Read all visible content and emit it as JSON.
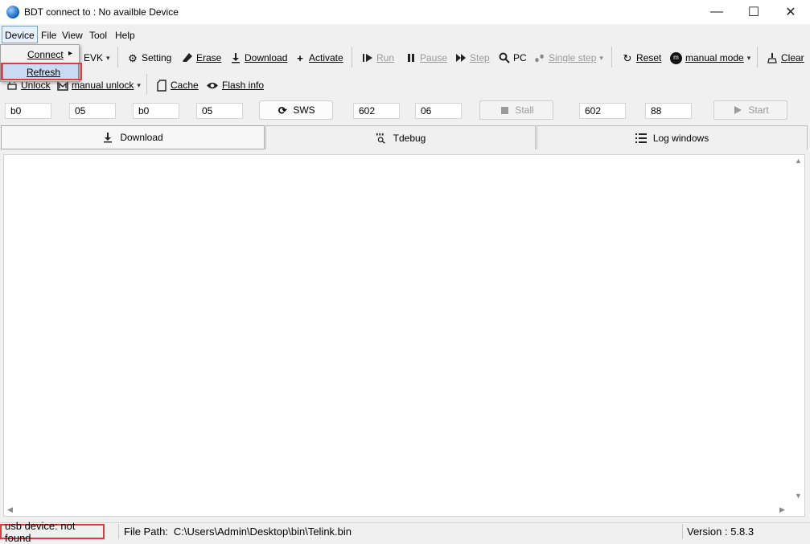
{
  "window": {
    "title": "BDT connect to : No availble Device",
    "minimize": "—",
    "maximize": "☐",
    "close": "✕"
  },
  "menubar": {
    "device": "Device",
    "file": "File",
    "view": "View",
    "tool": "Tool",
    "help": "Help"
  },
  "device_menu": {
    "connect": "Connect",
    "connect_arrow": "▸",
    "refresh": "Refresh"
  },
  "toolbar1": {
    "evk": "EVK",
    "evk_arrow": "▾",
    "setting": "Setting",
    "erase": "Erase",
    "download": "Download",
    "activate": "Activate",
    "run": "Run",
    "pause": "Pause",
    "step": "Step",
    "pc": "PC",
    "single_step": "Single step",
    "single_step_arrow": "▾",
    "reset": "Reset",
    "manual_mode": "manual mode",
    "manual_mode_arrow": "▾",
    "clear": "Clear"
  },
  "toolbar2": {
    "unlock": "Unlock",
    "manual_unlock": "manual unlock",
    "manual_unlock_arrow": "▾",
    "cache": "Cache",
    "flash_info": "Flash info"
  },
  "fields": {
    "f1": "b0",
    "f2": "05",
    "f3": "b0",
    "f4": "05",
    "sws_label": "SWS",
    "f5": "602",
    "f6": "06",
    "stall_label": "Stall",
    "f7": "602",
    "f8": "88",
    "start_label": "Start"
  },
  "tabs": {
    "download": "Download",
    "tdebug": "Tdebug",
    "log_windows": "Log windows"
  },
  "statusbar": {
    "usb_status": "usb device: not found",
    "file_path_label": "File Path:",
    "file_path": "C:\\Users\\Admin\\Desktop\\bin\\Telink.bin",
    "version": "Version : 5.8.3"
  },
  "colors": {
    "highlight_box": "#e5383b",
    "menu_selected": "#c9dcf4"
  }
}
